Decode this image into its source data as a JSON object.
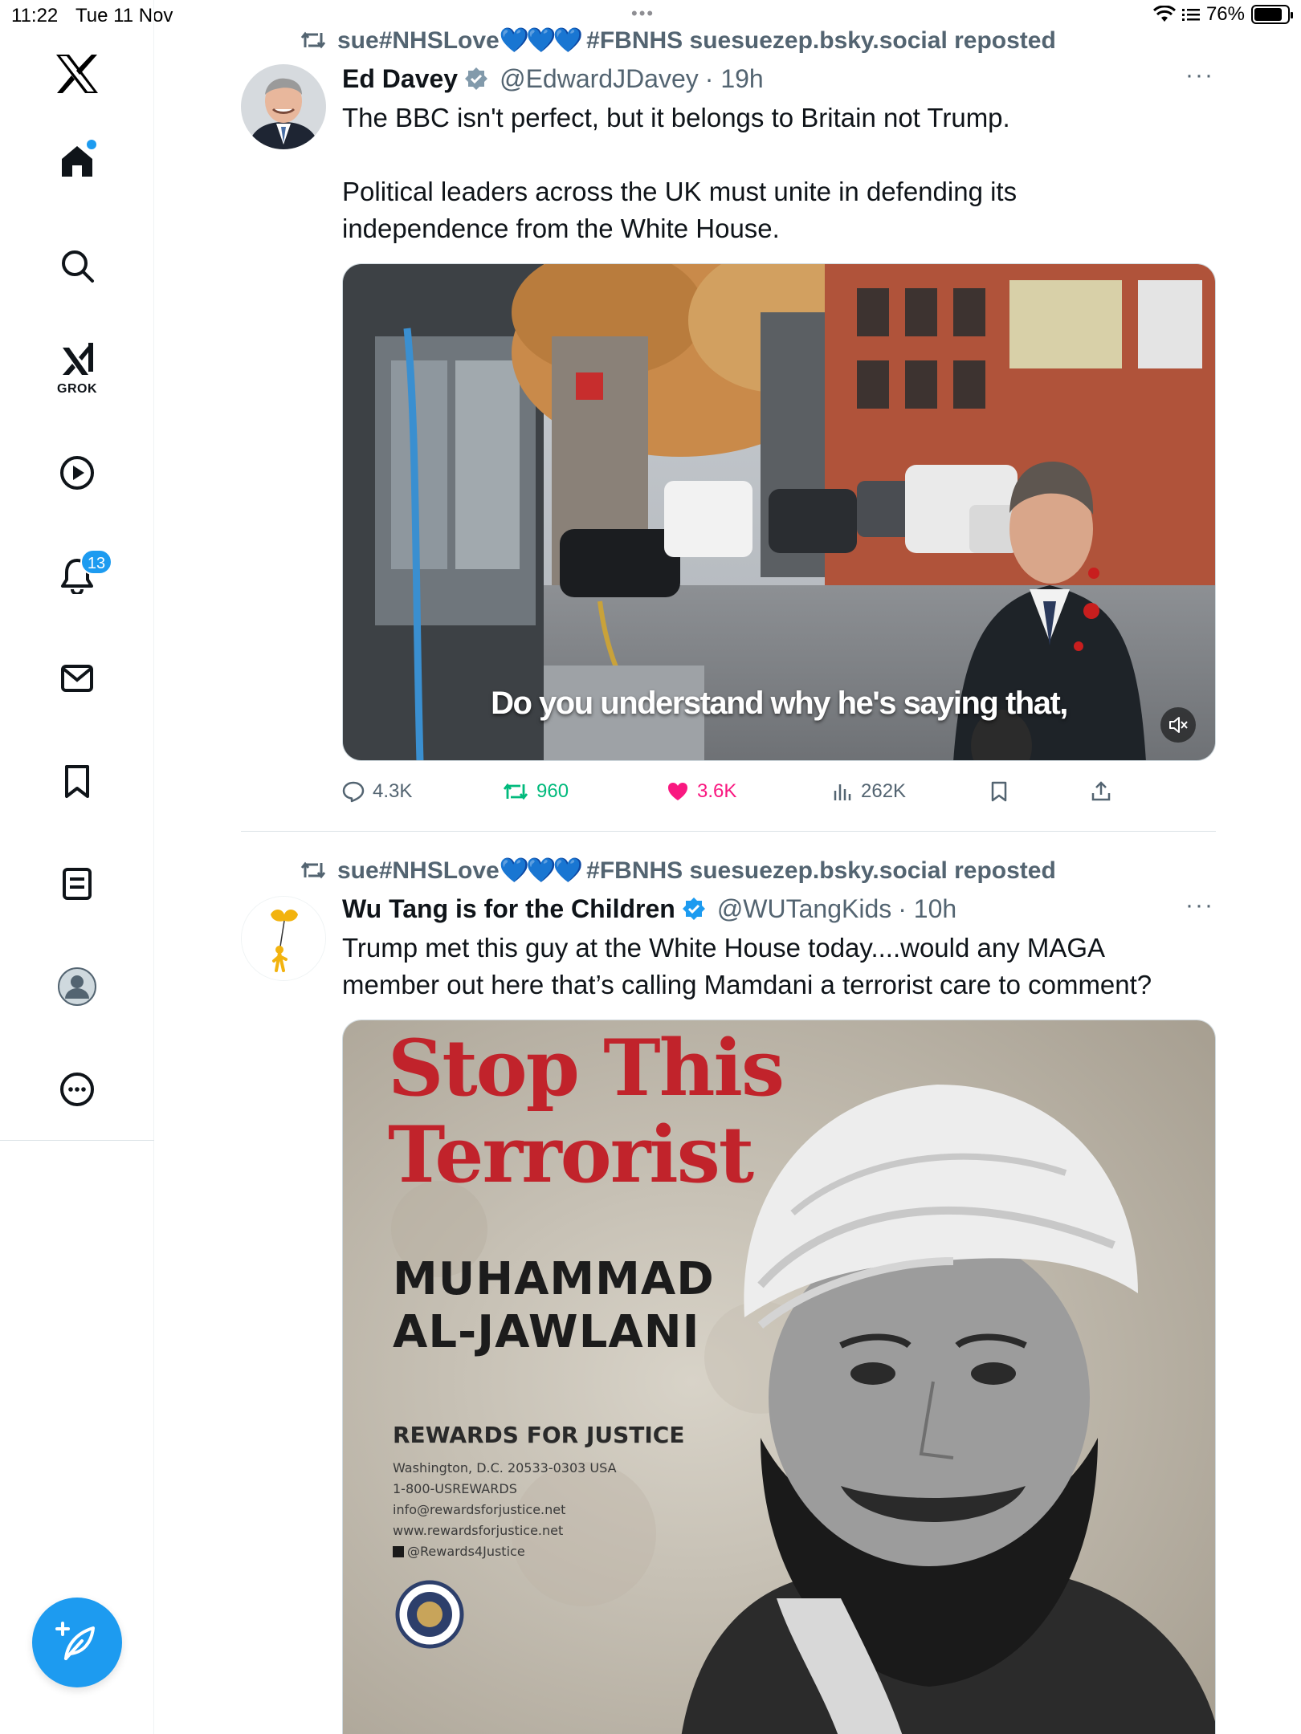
{
  "status_bar": {
    "time": "11:22",
    "date": "Tue 11 Nov",
    "battery": "76%"
  },
  "sidebar": {
    "grok_label": "GROK",
    "notifications_count": "13"
  },
  "posts": [
    {
      "repost_by": "sue#NHSLove",
      "repost_hearts": "💙💙💙",
      "repost_rest": "#FBNHS suesuezep.bsky.social reposted",
      "name": "Ed Davey",
      "handle": "@EdwardJDavey",
      "time": "· 19h",
      "text_line1": "The BBC isn't perfect, but it belongs to Britain not Trump.",
      "text_line2": "Political leaders across the UK must unite in defending its",
      "text_line3": "independence from the White House.",
      "video_caption": "Do you understand why he's saying that,",
      "replies": "4.3K",
      "reposts": "960",
      "likes": "3.6K",
      "views": "262K"
    },
    {
      "repost_by": "sue#NHSLove",
      "repost_hearts": "💙💙💙",
      "repost_rest": "#FBNHS suesuezep.bsky.social reposted",
      "name": "Wu Tang is for the Children",
      "handle": "@WUTangKids",
      "time": "· 10h",
      "text_line1": "Trump met this guy at the White House today....would any MAGA",
      "text_line2": "member out here that’s calling Mamdani a terrorist care to comment?",
      "poster": {
        "title_line1": "Stop This",
        "title_line2": "Terrorist",
        "name_line1": "MUHAMMAD",
        "name_line2": "AL-JAWLANI",
        "org": "REWARDS FOR JUSTICE",
        "contact1": "Washington, D.C. 20533-0303 USA",
        "contact2": "1-800-USREWARDS",
        "contact3": "info@rewardsforjustice.net",
        "contact4": "www.rewardsforjustice.net",
        "contact5": "@Rewards4Justice"
      }
    }
  ],
  "colors": {
    "accent": "#1d9bf0",
    "like": "#f91880",
    "repost": "#00ba7c",
    "muted": "#536471"
  }
}
